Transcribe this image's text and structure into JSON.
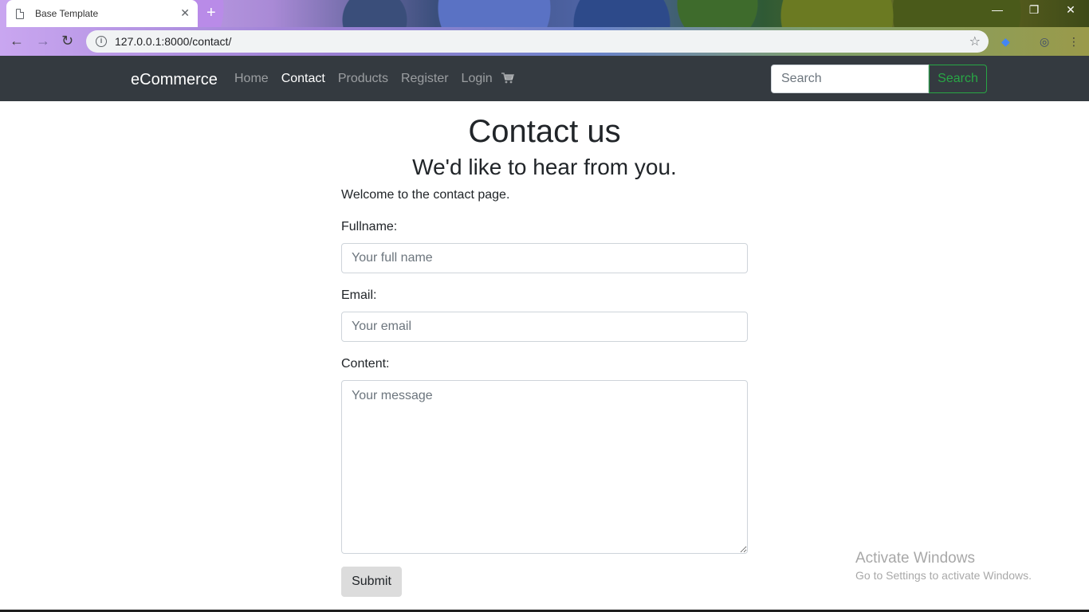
{
  "browser": {
    "tab_title": "Base Template",
    "new_tab_label": "+",
    "url": "127.0.0.1:8000/contact/",
    "window_controls": [
      "minimize-icon",
      "restore-icon",
      "close-icon"
    ]
  },
  "navbar": {
    "brand": "eCommerce",
    "links": [
      {
        "label": "Home",
        "active": false
      },
      {
        "label": "Contact",
        "active": true
      },
      {
        "label": "Products",
        "active": false
      },
      {
        "label": "Register",
        "active": false
      },
      {
        "label": "Login",
        "active": false
      }
    ],
    "cart_icon": "cart-icon",
    "search": {
      "placeholder": "Search",
      "button_label": "Search"
    }
  },
  "main": {
    "title": "Contact us",
    "subtitle": "We'd like to hear from you.",
    "intro": "Welcome to the contact page.",
    "form": {
      "fullname_label": "Fullname:",
      "fullname_placeholder": "Your full name",
      "email_label": "Email:",
      "email_placeholder": "Your email",
      "content_label": "Content:",
      "content_placeholder": "Your message",
      "submit_label": "Submit"
    }
  },
  "watermark": {
    "line1": "Activate Windows",
    "line2": "Go to Settings to activate Windows."
  },
  "colors": {
    "navbar_bg": "#343a40",
    "search_button": "#28a745"
  }
}
